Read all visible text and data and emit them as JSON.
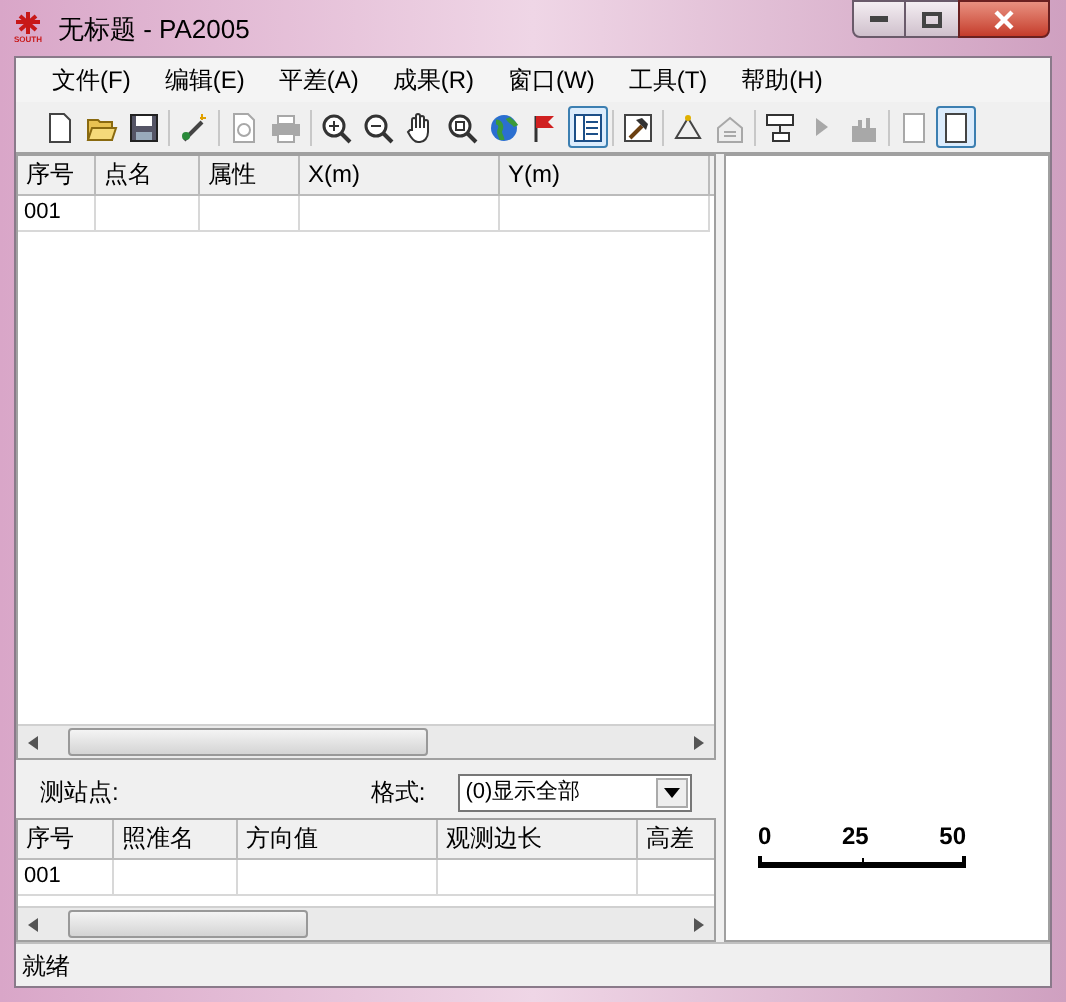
{
  "window": {
    "title": "无标题 - PA2005",
    "logo_text": "SOUTH"
  },
  "menu": [
    "文件(F)",
    "编辑(E)",
    "平差(A)",
    "成果(R)",
    "窗口(W)",
    "工具(T)",
    "帮助(H)"
  ],
  "toolbar": [
    {
      "kind": "new",
      "disabled": false,
      "selected": false
    },
    {
      "kind": "open",
      "disabled": false,
      "selected": false
    },
    {
      "kind": "save",
      "disabled": false,
      "selected": false
    },
    {
      "kind": "separator"
    },
    {
      "kind": "wand",
      "disabled": false,
      "selected": false
    },
    {
      "kind": "separator"
    },
    {
      "kind": "preview",
      "disabled": true,
      "selected": false
    },
    {
      "kind": "print",
      "disabled": true,
      "selected": false
    },
    {
      "kind": "separator"
    },
    {
      "kind": "zoomin",
      "disabled": false,
      "selected": false
    },
    {
      "kind": "zoomout",
      "disabled": false,
      "selected": false
    },
    {
      "kind": "hand",
      "disabled": false,
      "selected": false
    },
    {
      "kind": "zoomwin",
      "disabled": false,
      "selected": false
    },
    {
      "kind": "globe",
      "disabled": false,
      "selected": false
    },
    {
      "kind": "flag",
      "disabled": false,
      "selected": false
    },
    {
      "kind": "layout",
      "disabled": false,
      "selected": true
    },
    {
      "kind": "separator"
    },
    {
      "kind": "hammer",
      "disabled": false,
      "selected": false
    },
    {
      "kind": "separator"
    },
    {
      "kind": "triangle",
      "disabled": false,
      "selected": false
    },
    {
      "kind": "housedoc",
      "disabled": true,
      "selected": false
    },
    {
      "kind": "separator"
    },
    {
      "kind": "network",
      "disabled": false,
      "selected": false
    },
    {
      "kind": "play",
      "disabled": true,
      "selected": false
    },
    {
      "kind": "chart",
      "disabled": true,
      "selected": false
    },
    {
      "kind": "separator"
    },
    {
      "kind": "page",
      "disabled": true,
      "selected": false
    },
    {
      "kind": "page",
      "disabled": false,
      "selected": true
    }
  ],
  "points_table": {
    "columns": [
      "序号",
      "点名",
      "属性",
      "X(m)",
      "Y(m)"
    ],
    "rows": [
      [
        "001",
        "",
        "",
        "",
        ""
      ]
    ]
  },
  "observation": {
    "station_label": "测站点:",
    "format_label": "格式:",
    "format_value": "(0)显示全部"
  },
  "observation_table": {
    "columns": [
      "序号",
      "照准名",
      "方向值",
      "观测边长",
      "高差"
    ],
    "rows": [
      [
        "001",
        "",
        "",
        "",
        ""
      ]
    ]
  },
  "scale_bar": {
    "labels": [
      "0",
      "25",
      "50"
    ]
  },
  "status_bar": "就绪"
}
